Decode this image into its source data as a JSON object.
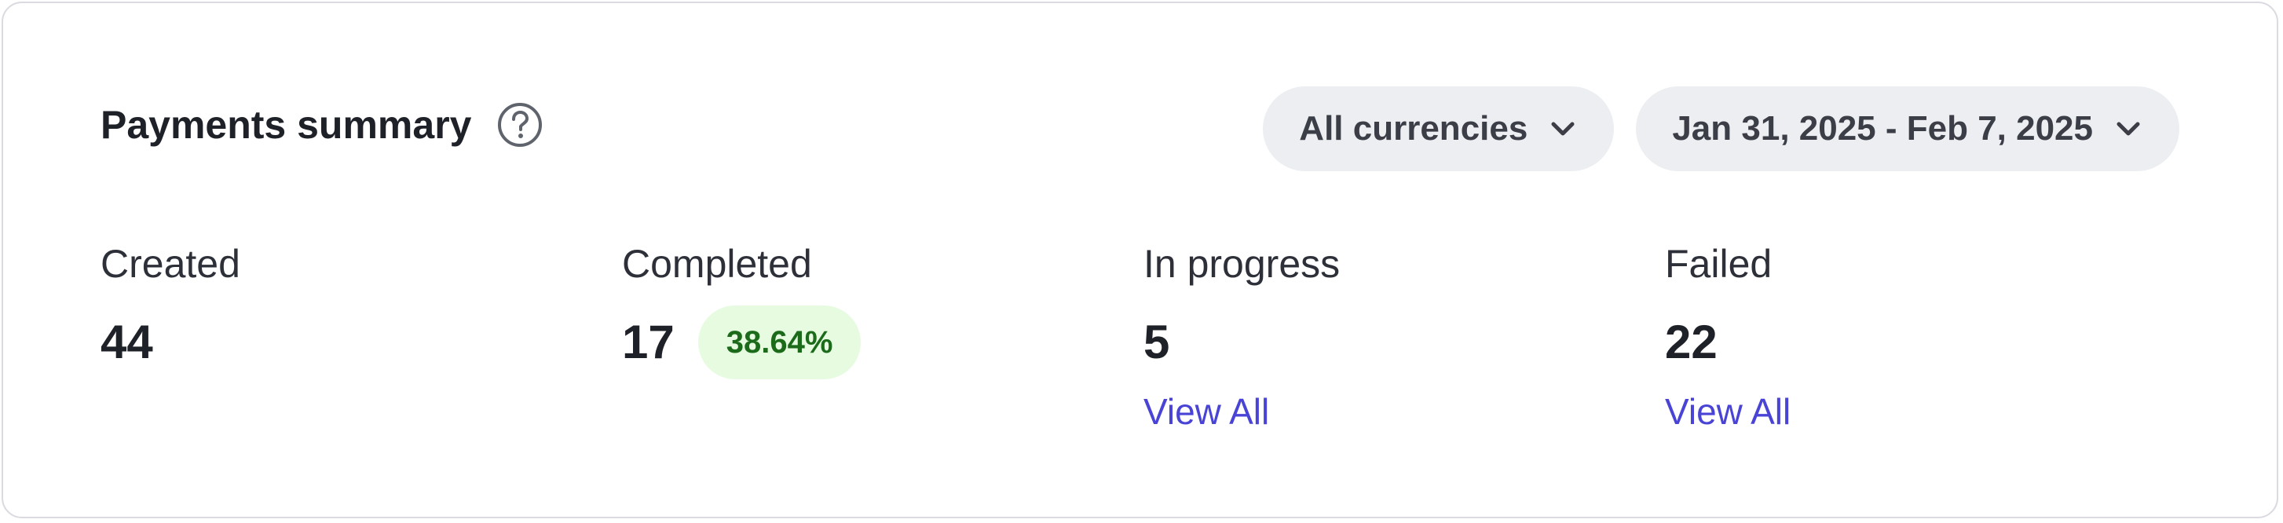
{
  "card": {
    "title": "Payments summary",
    "help_icon": "question-circle-icon"
  },
  "filters": {
    "currency_label": "All currencies",
    "date_range_label": "Jan 31, 2025 - Feb 7, 2025",
    "dropdown_icon": "chevron-down-icon"
  },
  "stats": {
    "created": {
      "label": "Created",
      "value": "44"
    },
    "completed": {
      "label": "Completed",
      "value": "17",
      "percent": "38.64%"
    },
    "in_progress": {
      "label": "In progress",
      "value": "5",
      "link": "View All"
    },
    "failed": {
      "label": "Failed",
      "value": "22",
      "link": "View All"
    }
  },
  "colors": {
    "link": "#4a44d6",
    "badge_bg": "#e6fbe0",
    "badge_text": "#1b6b1b",
    "pill_bg": "#eceef1"
  }
}
